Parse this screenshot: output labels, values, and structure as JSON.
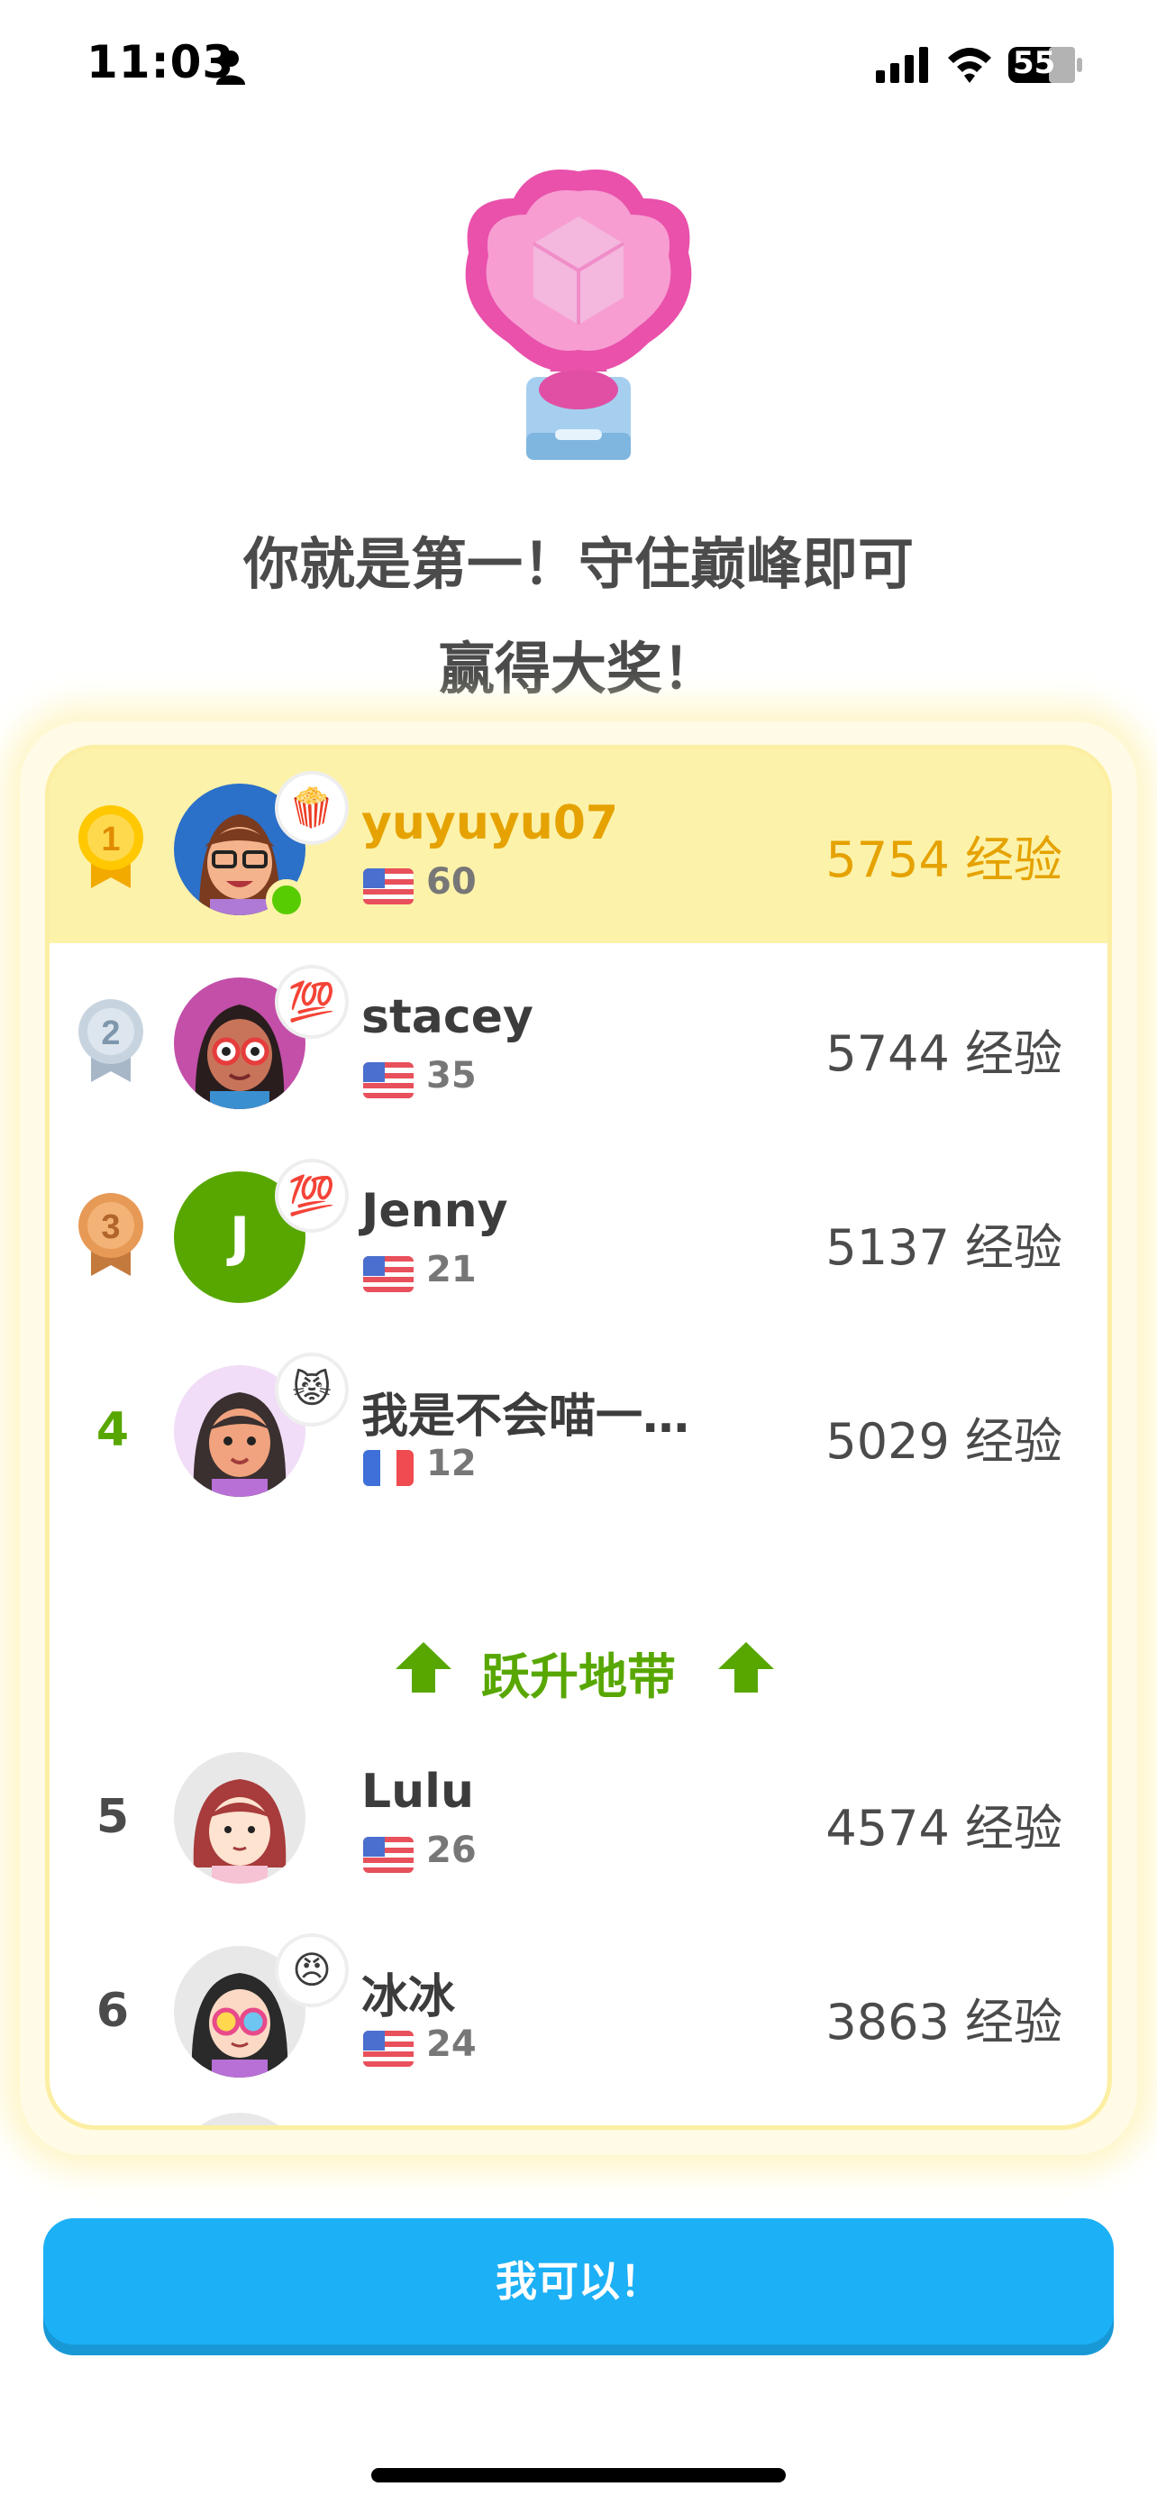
{
  "status_bar": {
    "time": "11:03",
    "battery": "55"
  },
  "headline": {
    "line1": "你就是第一！守住巅峰即可",
    "line2": "赢得大奖！"
  },
  "leaderboard": {
    "rows": [
      {
        "rank": "1",
        "name": "yuyuyu07",
        "streak": "60",
        "flag": "us",
        "xp": "5754 经验",
        "badge": "🍿",
        "highlight": true
      },
      {
        "rank": "2",
        "name": "stacey",
        "streak": "35",
        "flag": "us",
        "xp": "5744 经验",
        "badge": "💯"
      },
      {
        "rank": "3",
        "name": "Jenny",
        "streak": "21",
        "flag": "us",
        "xp": "5137 经验",
        "badge": "💯",
        "avatar_letter": "J"
      },
      {
        "rank": "4",
        "name": "我是不会喵一…",
        "streak": "12",
        "flag": "fr",
        "xp": "5029 经验",
        "badge": "😾"
      },
      {
        "rank": "5",
        "name": "Lulu",
        "streak": "26",
        "flag": "us",
        "xp": "4574 经验"
      },
      {
        "rank": "6",
        "name": "冰冰",
        "streak": "24",
        "flag": "us",
        "xp": "3863 经验",
        "badge": "😠"
      }
    ],
    "promotion_zone_label": "跃升地带"
  },
  "cta": {
    "label": "我可以！"
  },
  "colors": {
    "accent_blue": "#1cb0f6",
    "gold": "#e5a200",
    "green": "#58a700",
    "highlight": "#fdf2a9"
  }
}
